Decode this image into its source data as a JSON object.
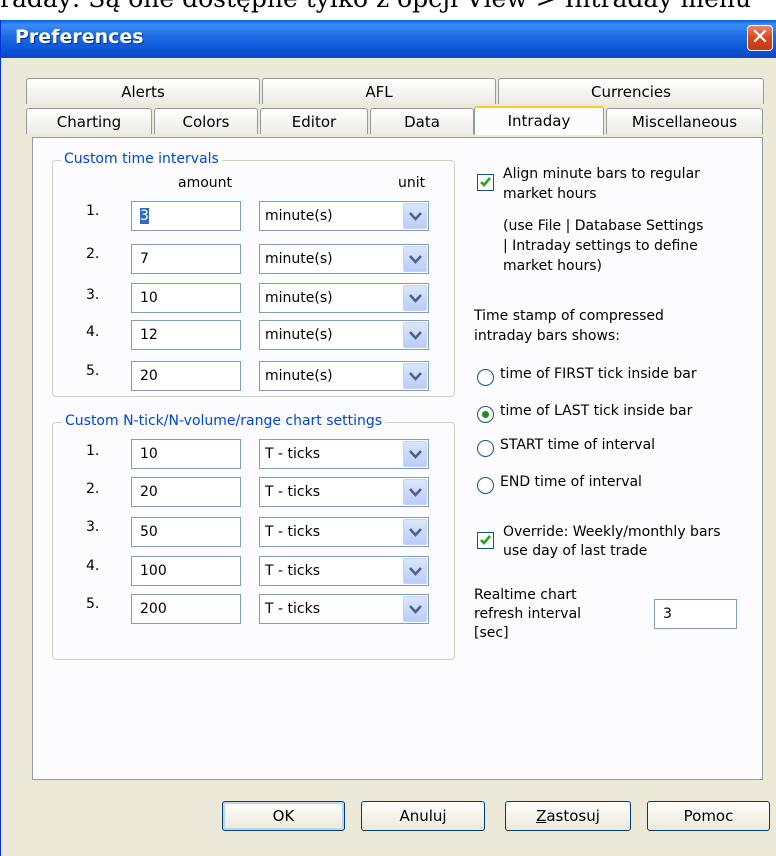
{
  "background_text": "raday: Są one dostępne tylko z opcji View > Intraday menu",
  "window": {
    "title": "Preferences",
    "close_symbol": "✕"
  },
  "tabs_row1": [
    "Alerts",
    "AFL",
    "Currencies"
  ],
  "tabs_row2": [
    "Charting",
    "Colors",
    "Editor",
    "Data",
    "Intraday",
    "Miscellaneous"
  ],
  "active_tab": "Intraday",
  "time_intervals": {
    "title": "Custom time intervals",
    "amount_header": "amount",
    "unit_header": "unit",
    "rows": [
      {
        "num": "1.",
        "amount": "3",
        "unit": "minute(s)"
      },
      {
        "num": "2.",
        "amount": "7",
        "unit": "minute(s)"
      },
      {
        "num": "3.",
        "amount": "10",
        "unit": "minute(s)"
      },
      {
        "num": "4.",
        "amount": "12",
        "unit": "minute(s)"
      },
      {
        "num": "5.",
        "amount": "20",
        "unit": "minute(s)"
      }
    ]
  },
  "ntick": {
    "title": "Custom N-tick/N-volume/range chart settings",
    "rows": [
      {
        "num": "1.",
        "amount": "10",
        "unit": "T - ticks"
      },
      {
        "num": "2.",
        "amount": "20",
        "unit": "T - ticks"
      },
      {
        "num": "3.",
        "amount": "50",
        "unit": "T - ticks"
      },
      {
        "num": "4.",
        "amount": "100",
        "unit": "T - ticks"
      },
      {
        "num": "5.",
        "amount": "200",
        "unit": "T - ticks"
      }
    ]
  },
  "right": {
    "align_checked": true,
    "align_label_1": "Align minute bars to regular",
    "align_label_2": "market hours",
    "note_1": "(use File | Database Settings",
    "note_2": "| Intraday settings to define",
    "note_3": "market hours)",
    "timestamp_1": "Time stamp of compressed",
    "timestamp_2": "intraday bars shows:",
    "radio_options": [
      "time of FIRST tick inside bar",
      "time of LAST tick inside bar",
      "START time of interval",
      "END time of interval"
    ],
    "radio_selected": 1,
    "override_checked": true,
    "override_label_1": "Override: Weekly/monthly bars",
    "override_label_2": "use day of last trade",
    "refresh_label_1": "Realtime chart",
    "refresh_label_2": "refresh interval",
    "refresh_label_3": "[sec]",
    "refresh_value": "3"
  },
  "buttons": {
    "ok": "OK",
    "cancel": "Anuluj",
    "apply_mnemonic": "Z",
    "apply_rest": "astosuj",
    "help": "Pomoc"
  },
  "colors": {
    "group_title": "#0046d5",
    "titlebar": "#0a52d6",
    "active_tab_accent": "#ffc83c",
    "radio_dot": "#218b21"
  }
}
